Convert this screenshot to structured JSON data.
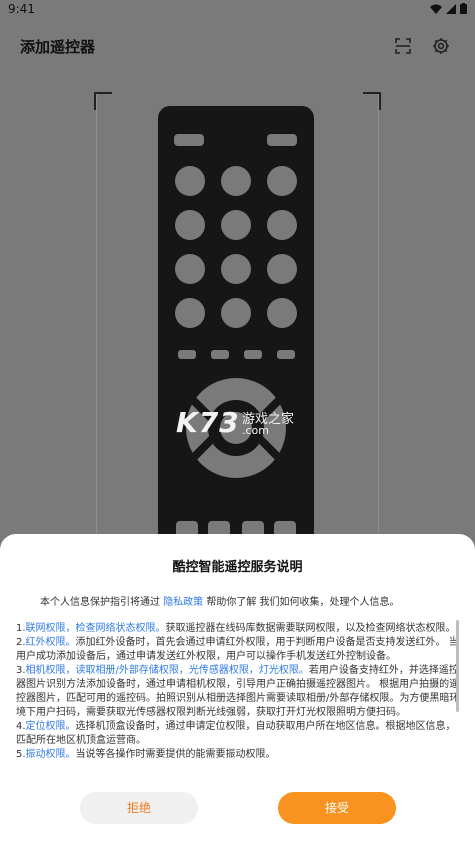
{
  "status_bar": {
    "time": "9:41"
  },
  "app_bar": {
    "title": "添加遥控器"
  },
  "watermark": {
    "logo": "K73",
    "text": "游戏之家",
    "sub": ".com"
  },
  "dialog": {
    "title": "酷控智能遥控服务说明",
    "intro_prefix": "本个人信息保护指引将通过",
    "intro_link": "隐私政策",
    "intro_suffix": "帮助你了解 我们如何收集，处理个人信息。",
    "sections": [
      {
        "num": "1.",
        "links": "联网权限，检查网络状态权限。",
        "text": "获取遥控器在线码库数据需要联网权限，以及检查网络状态权限。"
      },
      {
        "num": "2.",
        "links": "红外权限。",
        "text": "添加红外设备时，首先会通过申请红外权限，用于判断用户设备是否支持发送红外。 当用户成功添加设备后，通过申请发送红外权限，用户可以操作手机发送红外控制设备。"
      },
      {
        "num": "3.",
        "links": "相机权限，读取相册/外部存储权限，光传感器权限，灯光权限。",
        "text": "若用户设备支持红外，并选择遥控器图片识别方法添加设备时，通过申请相机权限，引导用户正确拍摄遥控器图片。 根据用户拍摄的遥控器图片，匹配可用的遥控码。拍照识别从相册选择图片需要读取相册/外部存储权限。为方便黑暗环境下用户扫码，需要获取光传感器权限判断光线强弱，获取打开灯光权限照明方便扫码。"
      },
      {
        "num": "4.",
        "links": "定位权限。",
        "text": "选择机顶盒设备时，通过申请定位权限，自动获取用户所在地区信息。根据地区信息，匹配所在地区机顶盒运营商。"
      },
      {
        "num": "5.",
        "links": "振动权限。",
        "text": "当说等各操作时需要提供的能需要振动权限。"
      }
    ],
    "decline_label": "拒绝",
    "accept_label": "接受"
  },
  "colors": {
    "accent": "#f7931e",
    "link": "#2f7ae5",
    "scrim": "#7a7a7a",
    "remote": "#161616"
  },
  "icons": [
    "wifi-icon",
    "signal-icon",
    "battery-icon",
    "scan-icon",
    "gear-icon"
  ]
}
